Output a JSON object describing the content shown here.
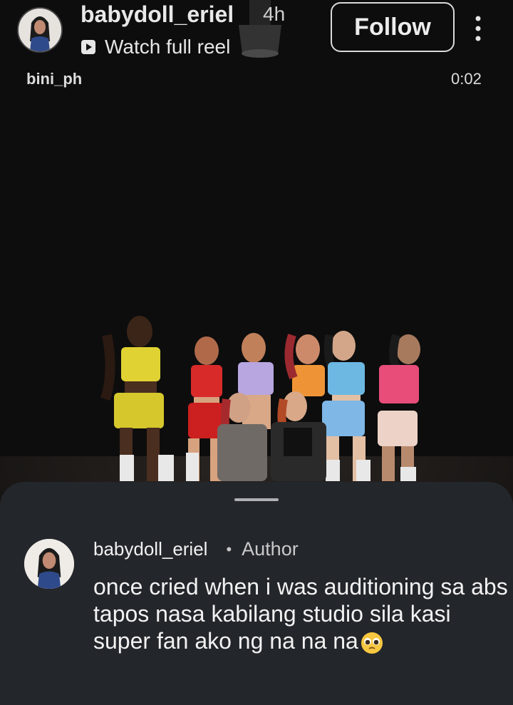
{
  "header": {
    "username": "babydoll_eriel",
    "time_ago": "4h",
    "watch_label": "Watch full reel",
    "follow_label": "Follow"
  },
  "video": {
    "source_tag": "bini_ph",
    "elapsed": "0:02"
  },
  "comment": {
    "username": "babydoll_eriel",
    "separator": "•",
    "badge": "Author",
    "text": "once cried when i was auditioning sa abs tapos nasa kabilang studio sila kasi super fan ako ng na na na",
    "emoji_icon": "pleading-face-emoji"
  },
  "colors": {
    "sheet_bg": "#23262b",
    "video_bg": "#0d0d0d",
    "text_primary": "#f2f2f2",
    "text_secondary": "#c9c9c9"
  }
}
